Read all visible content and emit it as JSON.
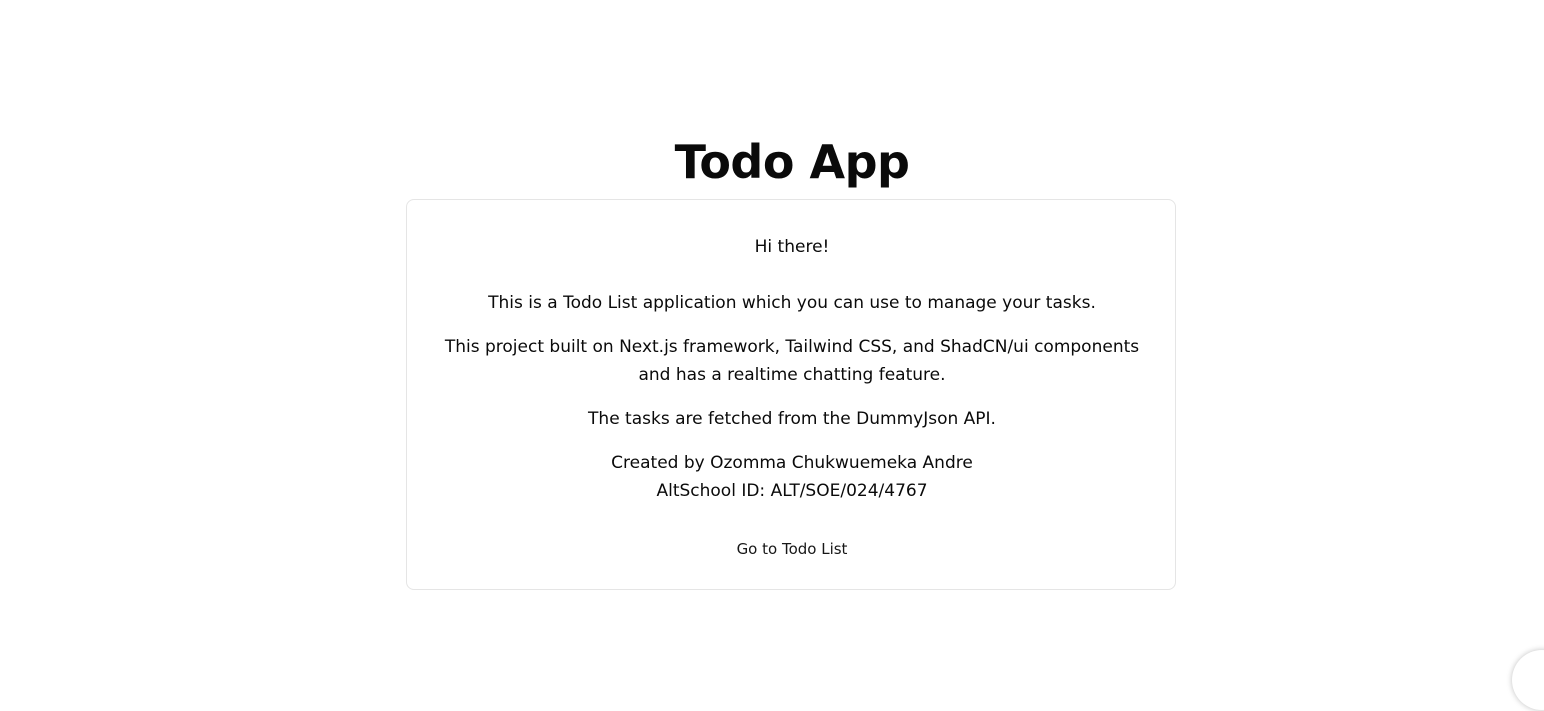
{
  "header": {
    "title": "Todo App"
  },
  "card": {
    "greeting": "Hi there!",
    "intro": "This is a Todo List application which you can use to manage your tasks.",
    "tech": "This project built on Next.js framework, Tailwind CSS, and ShadCN/ui components and has a realtime chatting feature.",
    "source": "The tasks are fetched from the DummyJson API.",
    "credit": "Created by Ozomma Chukwuemeka Andre",
    "credit_id": "AltSchool ID: ALT/SOE/024/4767",
    "button_label": "Go to Todo List"
  },
  "colors": {
    "background": "#ffffff",
    "text": "#0a0a0a",
    "card_border": "#e5e5e5"
  }
}
